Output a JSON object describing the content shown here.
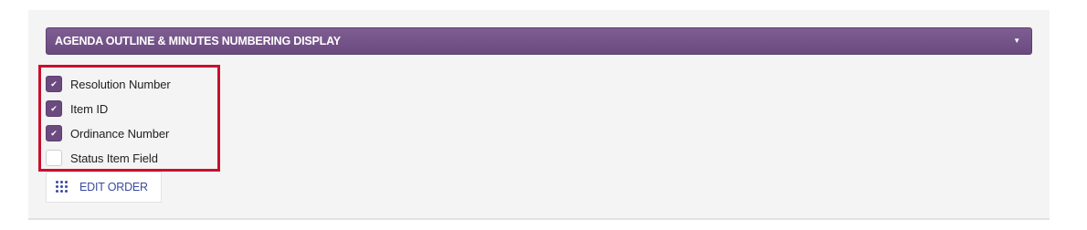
{
  "section": {
    "title": "AGENDA OUTLINE & MINUTES NUMBERING DISPLAY",
    "caret_icon": "caret-down-icon"
  },
  "options": [
    {
      "label": "Resolution Number",
      "checked": true
    },
    {
      "label": "Item ID",
      "checked": true
    },
    {
      "label": "Ordinance Number",
      "checked": true
    },
    {
      "label": "Status Item Field",
      "checked": false
    }
  ],
  "edit_order": {
    "label": "EDIT ORDER",
    "icon": "drag-grid-icon"
  },
  "colors": {
    "header_purple": "#6b4a80",
    "highlight_red": "#c8102e",
    "link_blue": "#3a4aa0"
  }
}
